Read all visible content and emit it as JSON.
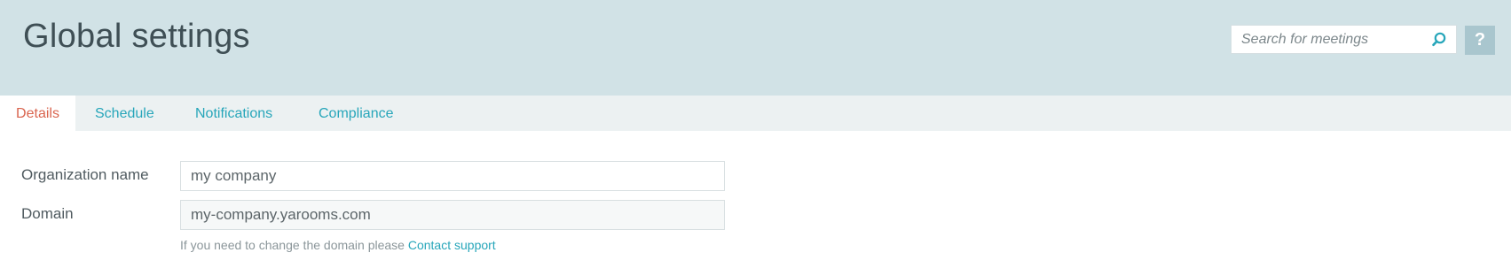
{
  "header": {
    "title": "Global settings",
    "search_placeholder": "Search for meetings",
    "help_label": "?"
  },
  "tabs": [
    {
      "label": "Details",
      "active": true
    },
    {
      "label": "Schedule",
      "active": false
    },
    {
      "label": "Notifications",
      "active": false
    },
    {
      "label": "Compliance",
      "active": false
    }
  ],
  "form": {
    "org_label": "Organization name",
    "org_value": "my company",
    "domain_label": "Domain",
    "domain_value": "my-company.yarooms.com",
    "hint_text": "If you need to change the domain please",
    "hint_link": "Contact support"
  },
  "colors": {
    "header_bg": "#d1e2e6",
    "tab_bar_bg": "#ecf1f2",
    "accent": "#27a6ba",
    "active_tab": "#d9644e"
  },
  "icons": {
    "search": "search-icon",
    "help": "help-icon"
  }
}
